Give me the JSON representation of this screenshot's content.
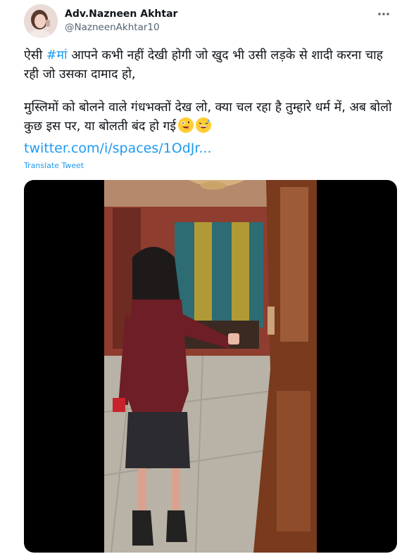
{
  "author": {
    "name": "Adv.Nazneen Akhtar",
    "handle": "@NazneenAkhtar10"
  },
  "menu": {
    "icon": "more-horizontal-icon"
  },
  "tweet": {
    "line1_prefix": "ऐसी ",
    "hashtag": "#मां",
    "line1_suffix": " आपने कभी नहीं देखी होगी जो खुद भी उसी लड़के से शादी करना चाह रही जो उसका दामाद हो,",
    "line2": "मुस्लिमों को बोलने वाले गंधभक्तों देख लो, क्या चल रहा है तुम्हारे धर्म में, अब बोलो कुछ इस पर, या बोलती बंद हो गई",
    "link": "twitter.com/i/spaces/1OdJr...",
    "translate": "Translate Tweet"
  },
  "emojis": [
    "zany-face-emoji",
    "grinning-sweat-emoji"
  ],
  "colors": {
    "accent": "#1d9bf0",
    "text": "#0f1419",
    "secondary": "#536471",
    "media_bg": "#000000"
  }
}
